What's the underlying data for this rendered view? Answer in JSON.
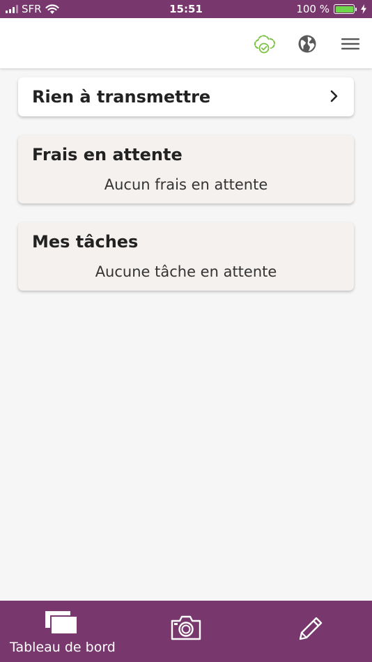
{
  "status_bar": {
    "carrier": "SFR",
    "time": "15:51",
    "battery_percent": "100 %",
    "battery_level": 1.0,
    "icons": [
      "signal-icon",
      "wifi-icon",
      "battery-icon",
      "charging-icon"
    ]
  },
  "header": {
    "icons": [
      "cloud-sync-check-icon",
      "globe-icon",
      "hamburger-menu-icon"
    ],
    "sync_color": "#7cc242"
  },
  "cards": {
    "transmit": {
      "title": "Rien à transmettre",
      "icon": "chevron-right-icon"
    },
    "pending_expenses": {
      "title": "Frais en attente",
      "empty_text": "Aucun frais en attente"
    },
    "tasks": {
      "title": "Mes tâches",
      "empty_text": "Aucune tâche en attente"
    }
  },
  "bottom_nav": {
    "dashboard_label": "Tableau de bord",
    "icons": [
      "dashboard-icon",
      "camera-icon",
      "pencil-icon"
    ]
  },
  "colors": {
    "brand": "#78386d",
    "card_bg": "#f5f1ef",
    "page_bg": "#f7f6f6"
  }
}
